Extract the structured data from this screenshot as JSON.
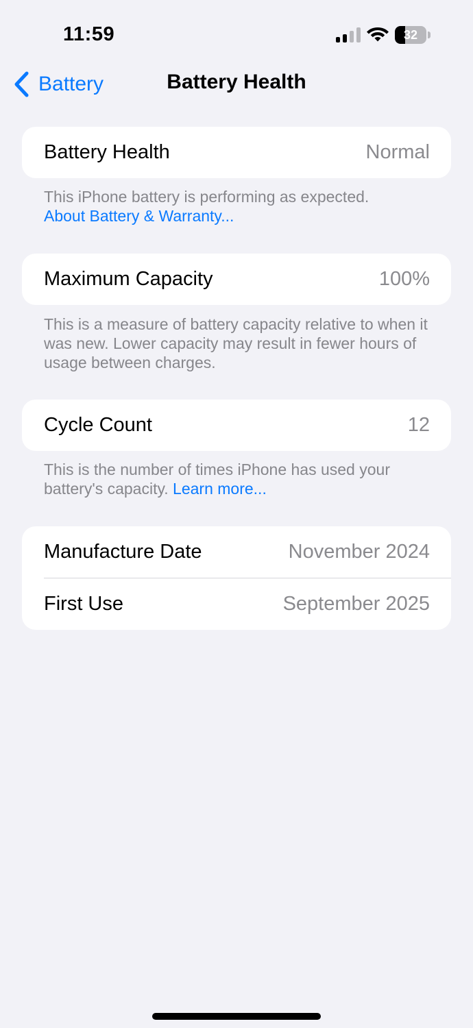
{
  "status_bar": {
    "time": "11:59",
    "signal_icon": "cellular-signal-icon",
    "signal_bars_active": 2,
    "signal_bars_total": 4,
    "wifi_icon": "wifi-icon",
    "battery_icon": "battery-icon",
    "battery_level": "32",
    "battery_fraction": 0.32
  },
  "nav": {
    "back_icon": "chevron-left-icon",
    "back_label": "Battery",
    "title": "Battery Health"
  },
  "health": {
    "label": "Battery Health",
    "value": "Normal",
    "footnote": "This iPhone battery is performing as expected.",
    "link": "About Battery & Warranty..."
  },
  "capacity": {
    "label": "Maximum Capacity",
    "value": "100%",
    "footnote": "This is a measure of battery capacity relative to when it was new. Lower capacity may result in fewer hours of usage between charges."
  },
  "cycles": {
    "label": "Cycle Count",
    "value": "12",
    "footnote": "This is the number of times iPhone has used your battery's capacity.",
    "link": "Learn more..."
  },
  "dates": {
    "manufacture_label": "Manufacture Date",
    "manufacture_value": "November 2024",
    "first_use_label": "First Use",
    "first_use_value": "September 2025"
  },
  "colors": {
    "accent": "#0a7aff",
    "background": "#f2f2f7",
    "secondary_text": "#8a8a8e"
  }
}
